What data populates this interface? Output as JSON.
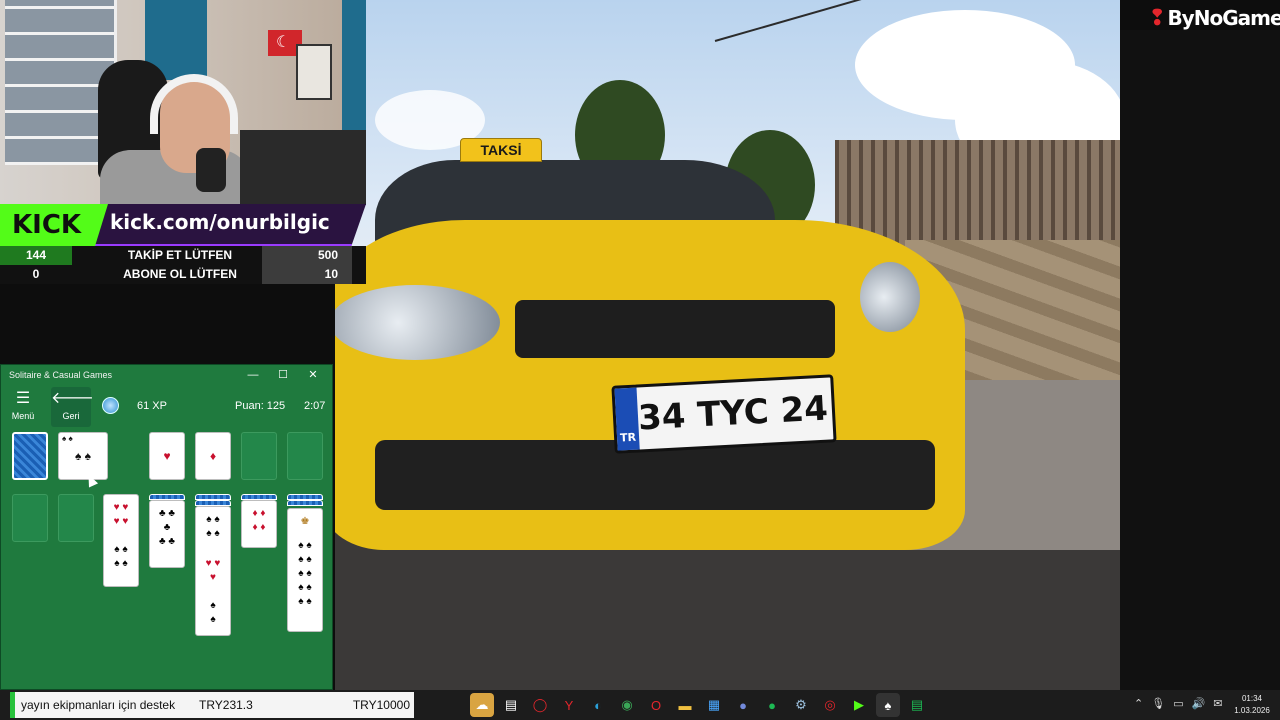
{
  "video": {
    "taxi_sign": "TAKSİ",
    "plate_country": "TR",
    "plate_number": "34 TYC 24"
  },
  "brand": {
    "name": "ByNoGame"
  },
  "kick": {
    "logo": "KICK",
    "url": "kick.com/onurbilgic",
    "stats": [
      {
        "left": "144",
        "label": "TAKİP ET LÜTFEN",
        "right": "500"
      },
      {
        "left": "0",
        "label": "ABONE OL LÜTFEN",
        "right": "10"
      }
    ]
  },
  "solitaire": {
    "window_title": "Solitaire & Casual Games",
    "minimize": "—",
    "maximize": "☐",
    "close": "✕",
    "menu_label": "Menü",
    "back_label": "Geri",
    "xp": "61 XP",
    "score": "Puan: 125",
    "time": "2:07"
  },
  "taskbar": {
    "donation_text": "yayın ekipmanları için destek",
    "donation_current": "TRY231.3",
    "donation_goal": "TRY10000",
    "clock_time": "01:34",
    "clock_date": "1.03.2026"
  }
}
